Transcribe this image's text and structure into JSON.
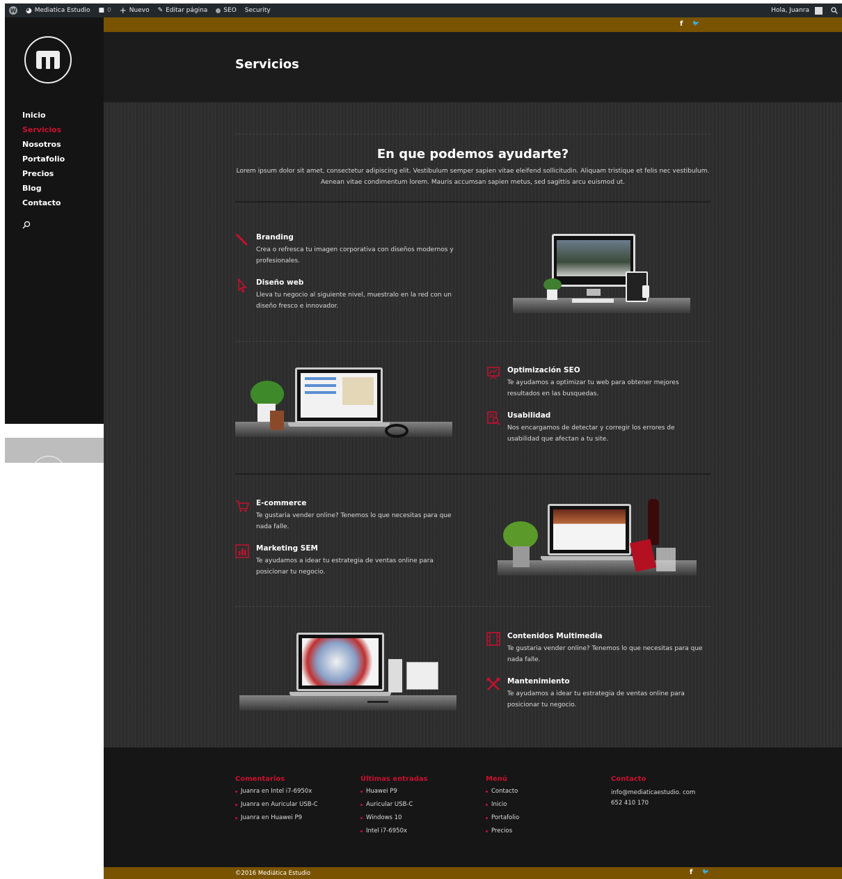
{
  "adminbar": {
    "site_name": "Mediatica Estudio",
    "comments_count": "0",
    "new_label": "Nuevo",
    "edit_label": "Editar página",
    "seo_label": "SEO",
    "security_label": "Security",
    "greeting": "Hola, Juanra"
  },
  "social": {
    "facebook": "f",
    "twitter": "🐦"
  },
  "sidebar": {
    "nav": [
      "Inicio",
      "Servicios",
      "Nosotros",
      "Portafolio",
      "Precios",
      "Blog",
      "Contacto"
    ],
    "active": "Servicios"
  },
  "page": {
    "title": "Servicios"
  },
  "intro": {
    "title": "En que podemos ayudarte?",
    "text": "Lorem ipsum dolor sit amet, consectetur adipiscing elit. Vestibulum semper sapien vitae eleifend sollicitudin. Aliquam tristique et felis nec vestibulum. Aenean vitae condimentum lorem. Mauris accumsan sapien metus, sed sagittis arcu euismod ut."
  },
  "features": [
    {
      "icon": "pencil-icon",
      "title": "Branding",
      "desc": "Crea o refresca tu imagen corporativa con diseños modernos y profesionales."
    },
    {
      "icon": "cursor-icon",
      "title": "Diseño web",
      "desc": "Lleva tu negocio al siguiente nivel, muestralo en la red con un diseño fresco e innovador."
    },
    {
      "icon": "chart-board-icon",
      "title": "Optimización SEO",
      "desc": "Te ayudamos a optimizar tu web para obtener mejores resultados en las busquedas."
    },
    {
      "icon": "document-search-icon",
      "title": "Usabilidad",
      "desc": "Nos encargamos de detectar y corregir los errores de usabilidad que afectan a tu site."
    },
    {
      "icon": "cart-icon",
      "title": "E-commerce",
      "desc": "Te gustaria vender online? Tenemos lo que necesitas para que nada falle."
    },
    {
      "icon": "bar-chart-icon",
      "title": "Marketing SEM",
      "desc": "Te ayudamos a idear tu estrategia de ventas online para posicionar tu negocio."
    },
    {
      "icon": "film-icon",
      "title": "Contenidos Multimedia",
      "desc": "Te gustaria vender online? Tenemos lo que necesitas para que nada falle."
    },
    {
      "icon": "tools-icon",
      "title": "Mantenimiento",
      "desc": "Te ayudamos a idear tu estrategia de ventas online para posicionar tu negocio."
    }
  ],
  "footer": {
    "comentarios": {
      "title": "Comentarios",
      "items": [
        "Juanra en Intel i7-6950x",
        "Juanra en Auricular USB-C",
        "Juanra en Huawei P9"
      ]
    },
    "entradas": {
      "title": "Últimas entradas",
      "items": [
        "Huawei P9",
        "Auricular USB-C",
        "Windows 10",
        "Intel i7-6950x"
      ]
    },
    "menu": {
      "title": "Menú",
      "items": [
        "Contacto",
        "Inicio",
        "Portafolio",
        "Precios"
      ]
    },
    "contacto": {
      "title": "Contacto",
      "email": "info@mediaticaestudio. com",
      "phone": "652 410 170"
    },
    "copyright": "©2016 Mediática Estudio"
  },
  "colors": {
    "accent": "#c8102e",
    "gold": "#7a5300",
    "bg": "#2c2c2c"
  }
}
